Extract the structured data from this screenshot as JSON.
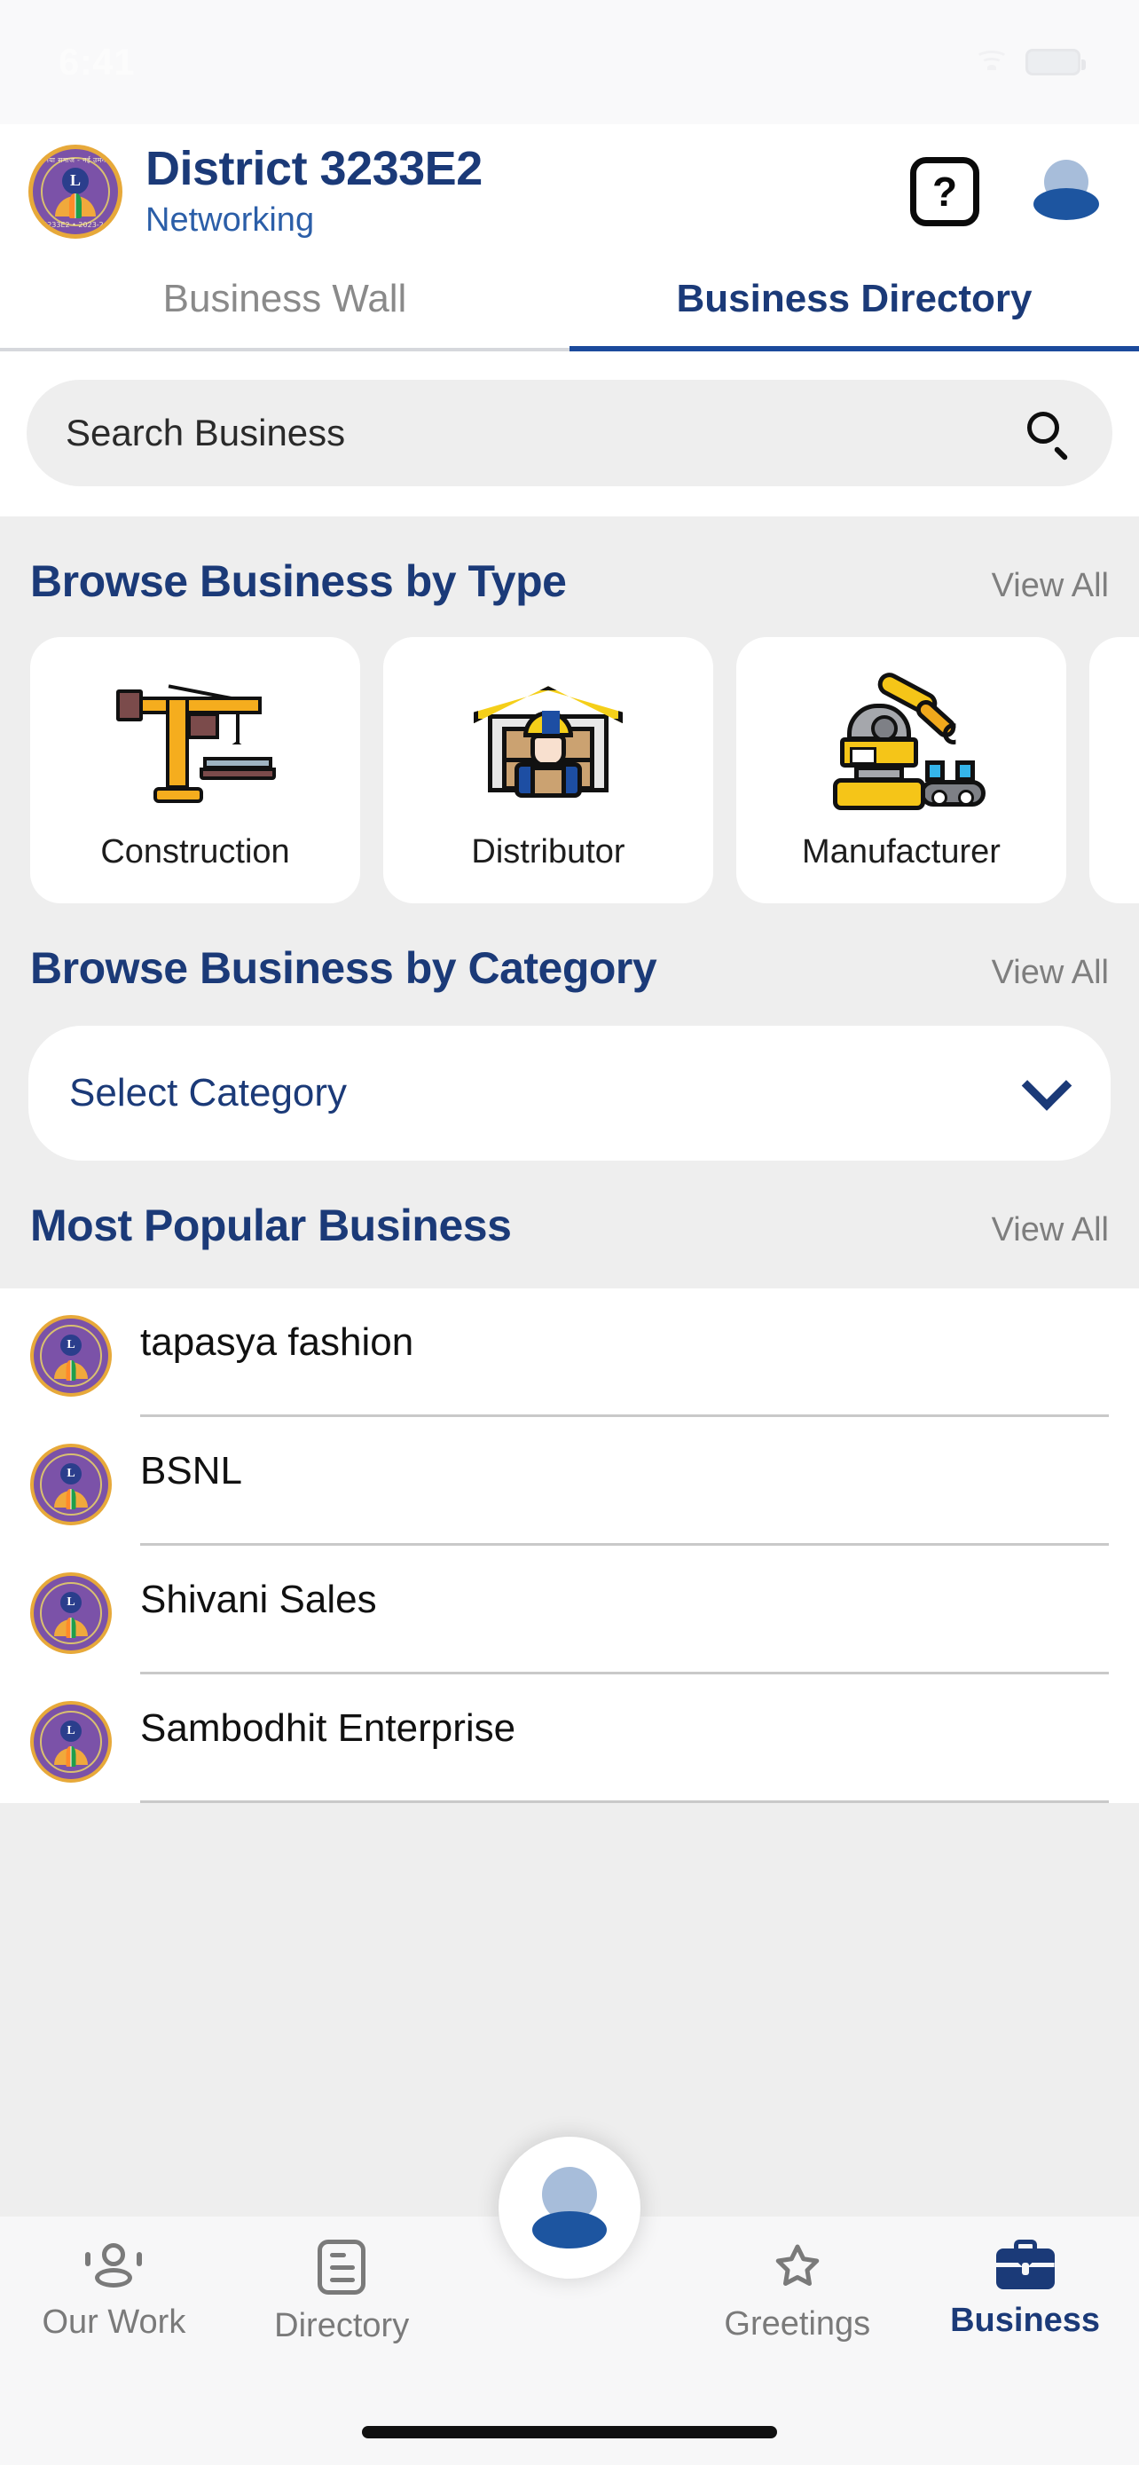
{
  "status_bar": {
    "time": "6:41",
    "wifi_icon": "wifi-icon",
    "battery_icon": "battery-icon"
  },
  "header": {
    "logo_alt": "lions-club-district-emblem",
    "logo_top_text": "नया समाज - नई उमंग",
    "logo_bottom_text": "3233E2 • 2023-24",
    "logo_letter": "L",
    "title": "District 3233E2",
    "subtitle": "Networking",
    "help_label": "?",
    "avatar_label": "profile-avatar"
  },
  "tabs": [
    {
      "label": "Business Wall",
      "active": false
    },
    {
      "label": "Business Directory",
      "active": true
    }
  ],
  "search": {
    "placeholder": "Search Business",
    "icon": "search-icon"
  },
  "sections": {
    "by_type": {
      "title": "Browse Business by Type",
      "view_all": "View All",
      "cards": [
        {
          "label": "Construction",
          "icon": "crane-icon"
        },
        {
          "label": "Distributor",
          "icon": "warehouse-worker-icon"
        },
        {
          "label": "Manufacturer",
          "icon": "robot-arm-conveyor-icon"
        }
      ]
    },
    "by_category": {
      "title": "Browse Business by Category",
      "view_all": "View All",
      "dropdown_value": "Select Category",
      "dropdown_icon": "chevron-down-icon"
    },
    "popular": {
      "title": "Most Popular Business",
      "view_all": "View All",
      "items": [
        {
          "name": "tapasya fashion"
        },
        {
          "name": "BSNL"
        },
        {
          "name": "Shivani Sales"
        },
        {
          "name": "Sambodhit Enterprise"
        }
      ]
    }
  },
  "bottom_nav": {
    "items": [
      {
        "label": "Our Work",
        "icon": "people-icon",
        "active": false
      },
      {
        "label": "Directory",
        "icon": "document-icon",
        "active": false
      },
      {
        "label": "Greetings",
        "icon": "star-icon",
        "active": false
      },
      {
        "label": "Business",
        "icon": "briefcase-icon",
        "active": true
      }
    ],
    "fab_icon": "profile-avatar-icon"
  },
  "colors": {
    "brand_navy": "#1b3a78",
    "accent_blue": "#1d55a0",
    "muted_gray": "#7a7a7a",
    "page_bg": "#eeeeee",
    "card_bg": "#ffffff",
    "logo_purple": "#7b52a8",
    "logo_gold": "#e7a93a"
  }
}
